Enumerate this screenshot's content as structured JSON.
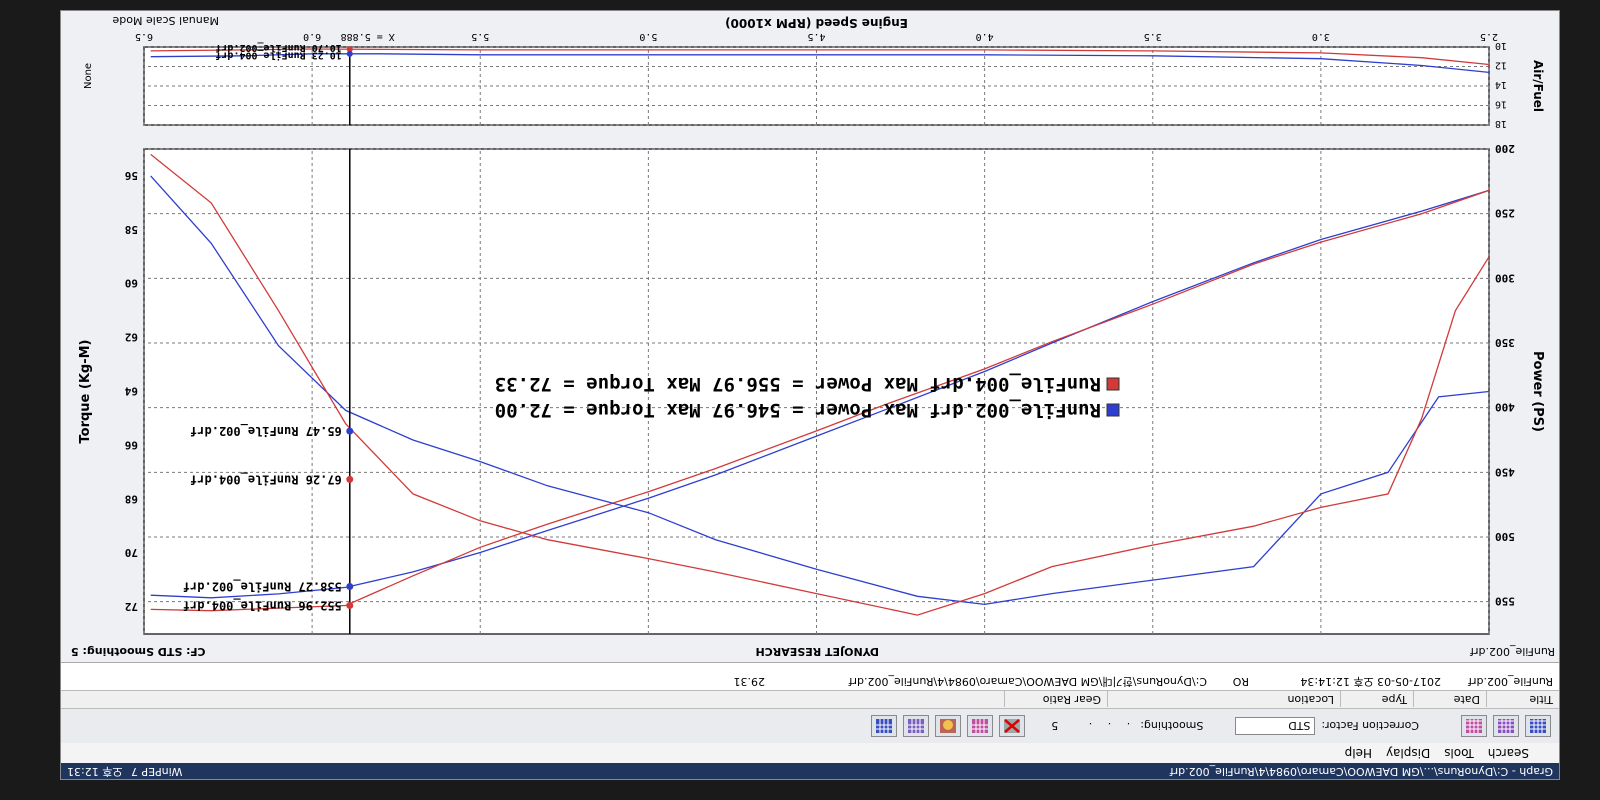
{
  "window": {
    "title": "Graph - C:\\DynoRuns\\...\\GM DAEWOO\\Camaro\\0984\\4\\RunFile_002.drf",
    "taskbar_app": "WinPEP 7",
    "clock": "오후 12:31"
  },
  "menu": [
    {
      "label": "Search",
      "key": "S"
    },
    {
      "label": "Tools",
      "key": "T"
    },
    {
      "label": "Display",
      "key": "D"
    },
    {
      "label": "Help",
      "key": "H"
    }
  ],
  "toolbar": {
    "correction_factor_label": "Correction Factor:",
    "correction_factor_value": "STD",
    "smoothing_label": "Smoothing:",
    "smoothing_value": "5",
    "icons": [
      "graph-grid-icon",
      "graph-grid-icon",
      "graph-grid-icon",
      "graph-grid-icon",
      "cancel-icon",
      "graph-grid-icon",
      "hand-icon",
      "graph-grid-icon",
      "graph-grid-icon"
    ]
  },
  "run_table": {
    "columns": [
      "Title",
      "Date",
      "Type",
      "Location",
      "Gear Ratio"
    ],
    "row": {
      "name": "RunFile_002.drf",
      "date": "2017-05-03 오후 12:14:34",
      "type": "RO",
      "location": "C:\\DynoRuns\\한기대\\GM DAEWOO\\Camaro\\0984\\4\\RunFile_002.drf",
      "gear_ratio": "29.31"
    }
  },
  "graph_header": {
    "run_label": "RunFile_002.drf",
    "brand": "DYNOJET RESEARCH",
    "cf_label": "CF: STD  Smoothing: 5"
  },
  "footer": {
    "mode": "Manual Scale Mode",
    "right_label": "None"
  },
  "colors": {
    "run002": "#2e3fd0",
    "run004": "#d23a3a",
    "grid": "#7a7a7a",
    "cursor": "#000000"
  },
  "chart_data": [
    {
      "type": "line",
      "title": "",
      "xlabel": "Engine Speed (RPM x1000)",
      "xlim": [
        2.5,
        6.5
      ],
      "xticks": [
        2.5,
        3.0,
        3.5,
        4.0,
        4.5,
        5.0,
        5.5,
        6.0,
        6.5
      ],
      "y_left": {
        "label": "Power (PS)",
        "lim": [
          200,
          575
        ],
        "ticks": [
          200,
          250,
          300,
          350,
          400,
          450,
          500,
          550
        ]
      },
      "y_right": {
        "label": "Torque (Kg-M)",
        "lim": [
          55,
          73
        ],
        "ticks": [
          56,
          58,
          60,
          62,
          64,
          66,
          68,
          70,
          72
        ]
      },
      "grid": true,
      "cursor": {
        "label": "X = 5.888",
        "x": 5.888
      },
      "legend": [
        {
          "label": "RunFile_002.drf Max Power = 546.97  Max Torque = 72.00",
          "color": "#2e3fd0"
        },
        {
          "label": "RunFile_004.drf Max Power = 556.97  Max Torque = 72.33",
          "color": "#d23a3a"
        }
      ],
      "readouts": [
        {
          "label": "552.96 RunFile_004.drf",
          "series": "RunFile_004.drf Power",
          "x": 5.888,
          "y": 552.96,
          "axis": "left",
          "color": "#d23a3a"
        },
        {
          "label": "538.27 RunFile_002.drf",
          "series": "RunFile_002.drf Power",
          "x": 5.888,
          "y": 538.27,
          "axis": "left",
          "color": "#2e3fd0"
        },
        {
          "label": "67.26 RunFile_004.drf",
          "series": "RunFile_004.drf Torque",
          "x": 5.888,
          "y": 67.26,
          "axis": "right",
          "color": "#d23a3a"
        },
        {
          "label": "65.47 RunFile_002.drf",
          "series": "RunFile_002.drf Torque",
          "x": 5.888,
          "y": 65.47,
          "axis": "right",
          "color": "#2e3fd0"
        }
      ],
      "series": [
        {
          "name": "RunFile_002.drf Power",
          "axis": "left",
          "color": "#2e3fd0",
          "x": [
            2.5,
            2.7,
            3.0,
            3.2,
            3.5,
            3.8,
            4.0,
            4.3,
            4.5,
            4.8,
            5.0,
            5.3,
            5.5,
            5.7,
            5.9,
            6.1,
            6.3,
            6.48
          ],
          "y": [
            232,
            248,
            270,
            288,
            318,
            350,
            372,
            402,
            422,
            452,
            470,
            495,
            512,
            527,
            539,
            544,
            547,
            545
          ]
        },
        {
          "name": "RunFile_004.drf Power",
          "axis": "left",
          "color": "#d23a3a",
          "x": [
            2.5,
            2.7,
            3.0,
            3.2,
            3.5,
            3.8,
            4.0,
            4.3,
            4.5,
            4.8,
            5.0,
            5.3,
            5.5,
            5.7,
            5.9,
            6.1,
            6.3,
            6.48
          ],
          "y": [
            232,
            250,
            272,
            289,
            320,
            349,
            370,
            398,
            418,
            447,
            465,
            490,
            508,
            530,
            553,
            555,
            557,
            556
          ]
        },
        {
          "name": "RunFile_002.drf Torque",
          "axis": "right",
          "color": "#2e3fd0",
          "x": [
            2.5,
            2.65,
            2.8,
            3.0,
            3.2,
            3.5,
            3.8,
            4.0,
            4.2,
            4.5,
            4.8,
            5.0,
            5.3,
            5.5,
            5.7,
            5.9,
            6.1,
            6.3,
            6.48
          ],
          "y": [
            64.0,
            64.2,
            67.0,
            67.8,
            70.5,
            71.0,
            71.5,
            71.9,
            71.6,
            70.6,
            69.5,
            68.5,
            67.5,
            66.6,
            65.8,
            64.7,
            62.3,
            58.5,
            56.0
          ]
        },
        {
          "name": "RunFile_004.drf Torque",
          "axis": "right",
          "color": "#d23a3a",
          "x": [
            2.5,
            2.6,
            2.7,
            2.8,
            3.0,
            3.2,
            3.5,
            3.8,
            4.0,
            4.2,
            4.5,
            4.8,
            5.0,
            5.3,
            5.5,
            5.7,
            5.9,
            6.1,
            6.3,
            6.48
          ],
          "y": [
            59.0,
            61.0,
            65.0,
            67.8,
            68.3,
            69.0,
            69.7,
            70.5,
            71.5,
            72.3,
            71.5,
            70.7,
            70.2,
            69.5,
            68.8,
            67.8,
            65.2,
            61.0,
            57.0,
            55.2
          ]
        }
      ]
    },
    {
      "type": "line",
      "xlabel": "",
      "xlim": [
        2.5,
        6.5
      ],
      "ylabel": "Air/Fuel",
      "ylim": [
        10,
        18
      ],
      "yticks": [
        10,
        12,
        14,
        16,
        18
      ],
      "grid": true,
      "readouts": [
        {
          "label": "10.23 RunFile_004.drf",
          "series": "RunFile_004.drf AFR",
          "x": 5.888,
          "y": 10.23,
          "color": "#d23a3a"
        },
        {
          "label": "10.70 RunFile_002.drf",
          "series": "RunFile_002.drf AFR",
          "x": 5.888,
          "y": 10.7,
          "color": "#2e3fd0"
        }
      ],
      "series": [
        {
          "name": "RunFile_002.drf AFR",
          "color": "#2e3fd0",
          "x": [
            2.5,
            2.7,
            3.0,
            3.5,
            4.0,
            4.5,
            5.0,
            5.5,
            5.8,
            6.0,
            6.2,
            6.48
          ],
          "y": [
            12.6,
            11.9,
            11.2,
            10.9,
            10.8,
            10.8,
            10.8,
            10.8,
            10.7,
            10.7,
            10.9,
            11.0
          ]
        },
        {
          "name": "RunFile_004.drf AFR",
          "color": "#d23a3a",
          "x": [
            2.5,
            2.7,
            3.0,
            3.5,
            4.0,
            4.5,
            5.0,
            5.5,
            5.8,
            6.0,
            6.2,
            6.48
          ],
          "y": [
            11.8,
            11.1,
            10.6,
            10.4,
            10.3,
            10.3,
            10.3,
            10.3,
            10.25,
            10.2,
            10.3,
            10.4
          ]
        }
      ]
    }
  ]
}
